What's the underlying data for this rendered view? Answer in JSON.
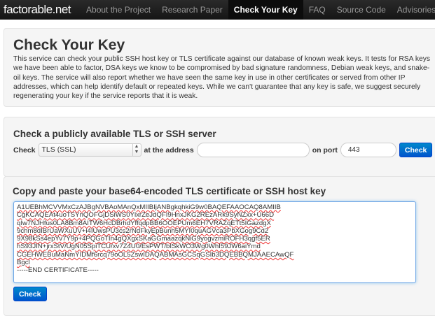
{
  "nav": {
    "brand": "factorable.net",
    "items": [
      "About the Project",
      "Research Paper",
      "Check Your Key",
      "FAQ",
      "Source Code",
      "Advisories"
    ],
    "active": "Check Your Key"
  },
  "intro": {
    "title": "Check Your Key",
    "text": "This service can check your public SSH host key or TLS certificate against our database of known weak keys. It tests for RSA keys we have been able to factor, DSA keys we know to be compromised by bad signature randomness, Debian weak keys, and snake-oil keys. The service will also report whether we have seen the same key in use in other certificates or served from other IP addresses, which can help identify default or repeated keys. While we can't guarantee that any key is safe, we suggest securely regenerating your key if the service reports that it is weak."
  },
  "server_check": {
    "title": "Check a publicly available TLS or SSH server",
    "check_label": "Check",
    "protocol": "TLS (SSL)",
    "address_label": "at the address",
    "address_value": "",
    "port_label": "on port",
    "port_value": "443",
    "button": "Check"
  },
  "paste_check": {
    "title": "Copy and paste your base64-encoded TLS certificate or SSH host key",
    "lines": [
      "A1UEBhMCVVMxCzAJBgNVBAoMAnQxMIIBIjANBgkqhkiG9w0BAQEFAAOCAQ8AMIIB",
      "CgKCAQEAt4uoTSYnQOFGjDSiWS0YlxrZeJdQFI9HnxJKG2REzARk9SyNZxx+U66D",
      "qIw7NJHfus0LA8Bm8AITW6HcDBrhdYffqdpBB6OOEPUm6EH7VRAZqETt5IGazdgX",
      "9chm8dIBrUaWXuUV+i4IUwsPU3cs2rNdFkyEpBunh5MYI0quAGVca3PbXGog9Cd2",
      "9X98kSs4epYv7Y9p+4PQGoTIn4gQXgxSKaGGmaazqkNiG9yogvzmiROFH3qgf5ER",
      "hS93JIN+jrxStV/UgN05SpiTCU/xv7Z4U0/EsPWT/bISkWO3Wg0WhI59JW6aiYmd",
      "CGEHWEBuMaNmYIDMf6rcq79oOL5ZswIDAQABMAsGCSqGSIb3DQEBBQMJAAECAwQF",
      "Bgcl"
    ],
    "end_line": "-----END CERTIFICATE-----",
    "button": "Check"
  }
}
